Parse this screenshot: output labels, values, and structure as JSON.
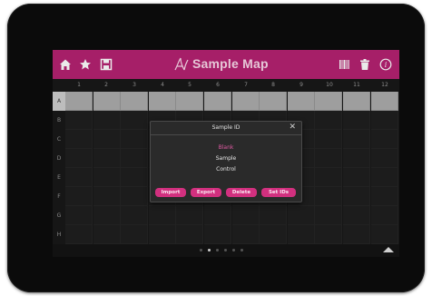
{
  "header": {
    "title": "Sample Map",
    "icons": [
      "home-icon",
      "star-icon",
      "save-icon",
      "sample-logo-icon",
      "barcode-icon",
      "trash-icon",
      "info-icon"
    ]
  },
  "grid": {
    "columns": [
      "1",
      "2",
      "3",
      "4",
      "5",
      "6",
      "7",
      "8",
      "9",
      "10",
      "11",
      "12"
    ],
    "rows": [
      "A",
      "B",
      "C",
      "D",
      "E",
      "F",
      "G",
      "H"
    ],
    "selected_row": "A"
  },
  "dialog": {
    "title": "Sample ID",
    "options": [
      "Blank",
      "Sample",
      "Control"
    ],
    "active_option": "Blank",
    "buttons": [
      "Import",
      "Export",
      "Delete",
      "Set IDs"
    ]
  },
  "pager": {
    "pages": 6,
    "current": 2
  },
  "colors": {
    "accent": "#a61f68",
    "button": "#d2307f",
    "active_option": "#e05aa3"
  }
}
